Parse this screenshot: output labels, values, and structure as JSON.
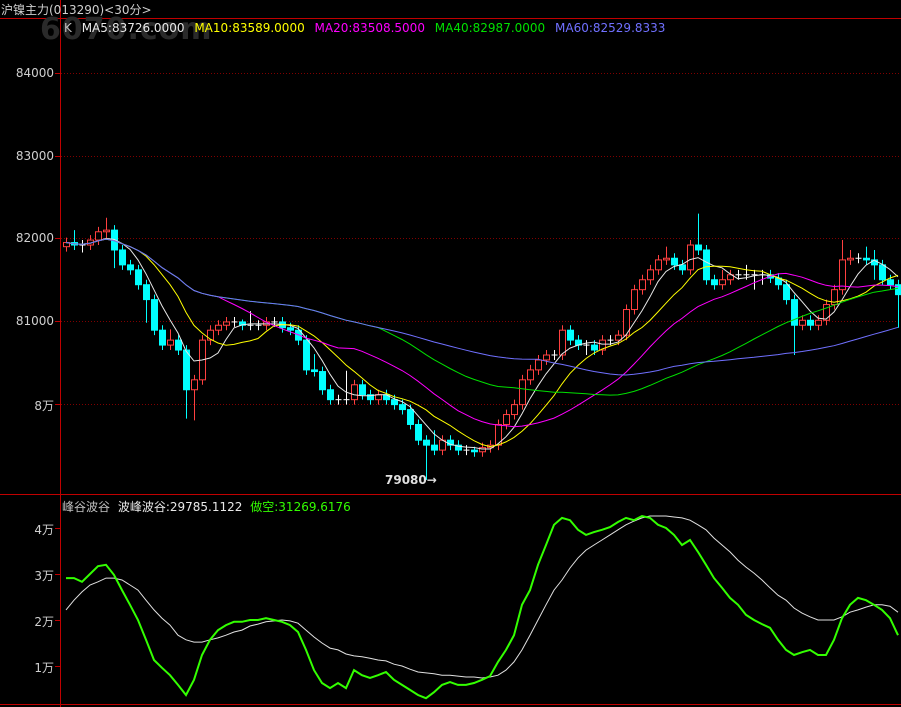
{
  "header": {
    "title": "沪镍主力(013290)<30分>",
    "watermark": "6070.com"
  },
  "legend": {
    "k": "K",
    "ma5": "MA5:83726.0000",
    "ma10": "MA10:83589.0000",
    "ma20": "MA20:83508.5000",
    "ma40": "MA40:82987.0000",
    "ma60": "MA60:82529.8333"
  },
  "colors": {
    "up": "#ff4040",
    "down": "#00ffff",
    "ma5": "#e8e8e8",
    "ma10": "#ffff00",
    "ma20": "#ff00ff",
    "ma40": "#00e000",
    "ma60": "#7070ff",
    "grid": "#800000",
    "frame": "#c00000",
    "ind_white": "#e0e0e0",
    "ind_green": "#33ff00"
  },
  "indicator_legend": {
    "name": "峰谷波谷",
    "white": "波峰波谷:29785.1122",
    "green": "做空:31269.6176"
  },
  "chart_data": [
    {
      "type": "candlestick",
      "title": "沪镍主力(013290)<30分>",
      "y_ticks": [
        {
          "value": 84000,
          "label": "84000"
        },
        {
          "value": 83000,
          "label": "83000"
        },
        {
          "value": 82000,
          "label": "82000"
        },
        {
          "value": 81000,
          "label": "81000"
        },
        {
          "value": 80000,
          "label": "8万"
        }
      ],
      "ylim": [
        79000,
        84900
      ],
      "grid": true,
      "annotation": {
        "label": "79080→",
        "value": 79080
      },
      "ma_periods": [
        5,
        10,
        20,
        40,
        60
      ],
      "candles_ohlc": [
        [
          81900,
          82010,
          81840,
          81950
        ],
        [
          81950,
          82100,
          81860,
          81920
        ],
        [
          81920,
          81980,
          81830,
          81920
        ],
        [
          81920,
          82040,
          81860,
          81980
        ],
        [
          81980,
          82140,
          81920,
          82080
        ],
        [
          82080,
          82250,
          82000,
          82100
        ],
        [
          82100,
          82160,
          81640,
          81860
        ],
        [
          81860,
          81920,
          81620,
          81680
        ],
        [
          81680,
          81740,
          81560,
          81620
        ],
        [
          81620,
          81680,
          81380,
          81440
        ],
        [
          81440,
          81500,
          80980,
          81260
        ],
        [
          81260,
          81320,
          80830,
          80890
        ],
        [
          80890,
          80950,
          80650,
          80710
        ],
        [
          80710,
          80900,
          80650,
          80770
        ],
        [
          80770,
          80830,
          80590,
          80650
        ],
        [
          80650,
          80710,
          79820,
          80170
        ],
        [
          80170,
          80350,
          79800,
          80290
        ],
        [
          80290,
          80830,
          80230,
          80770
        ],
        [
          80770,
          80950,
          80710,
          80890
        ],
        [
          80890,
          81010,
          80830,
          80950
        ],
        [
          80950,
          81050,
          80890,
          80990
        ],
        [
          80990,
          81050,
          80930,
          80990
        ],
        [
          80990,
          81020,
          80890,
          80950
        ],
        [
          80950,
          81120,
          80890,
          80950
        ],
        [
          80950,
          81010,
          80890,
          80950
        ],
        [
          80950,
          81050,
          80890,
          80990
        ],
        [
          80990,
          81050,
          80930,
          80990
        ],
        [
          80990,
          81050,
          80860,
          80920
        ],
        [
          80920,
          80980,
          80830,
          80890
        ],
        [
          80890,
          80950,
          80710,
          80770
        ],
        [
          80770,
          80830,
          80350,
          80410
        ],
        [
          80410,
          80600,
          80330,
          80390
        ],
        [
          80390,
          80450,
          80110,
          80170
        ],
        [
          80170,
          80230,
          79990,
          80050
        ],
        [
          80050,
          80110,
          79990,
          80050
        ],
        [
          80050,
          80400,
          79990,
          80050
        ],
        [
          80050,
          80290,
          79990,
          80230
        ],
        [
          80230,
          80290,
          80050,
          80110
        ],
        [
          80110,
          80170,
          79990,
          80050
        ],
        [
          80050,
          80170,
          79990,
          80110
        ],
        [
          80110,
          80170,
          79990,
          80050
        ],
        [
          80050,
          80110,
          79930,
          79990
        ],
        [
          79990,
          80050,
          79870,
          79930
        ],
        [
          79930,
          79990,
          79690,
          79750
        ],
        [
          79750,
          79810,
          79500,
          79560
        ],
        [
          79560,
          79620,
          79080,
          79500
        ],
        [
          79500,
          79680,
          79380,
          79440
        ],
        [
          79440,
          79620,
          79380,
          79560
        ],
        [
          79560,
          79620,
          79440,
          79500
        ],
        [
          79500,
          79560,
          79380,
          79440
        ],
        [
          79440,
          79500,
          79380,
          79440
        ],
        [
          79440,
          79480,
          79360,
          79420
        ],
        [
          79420,
          79530,
          79360,
          79470
        ],
        [
          79470,
          79560,
          79410,
          79500
        ],
        [
          79500,
          79810,
          79440,
          79750
        ],
        [
          79750,
          79930,
          79690,
          79870
        ],
        [
          79870,
          80050,
          79810,
          79990
        ],
        [
          79990,
          80350,
          79930,
          80290
        ],
        [
          80290,
          80470,
          80230,
          80410
        ],
        [
          80410,
          80590,
          80350,
          80530
        ],
        [
          80530,
          80650,
          80470,
          80590
        ],
        [
          80590,
          80650,
          80530,
          80590
        ],
        [
          80590,
          80950,
          80530,
          80890
        ],
        [
          80890,
          80950,
          80710,
          80770
        ],
        [
          80770,
          80830,
          80650,
          80710
        ],
        [
          80710,
          80770,
          80590,
          80710
        ],
        [
          80710,
          80770,
          80590,
          80650
        ],
        [
          80650,
          80830,
          80590,
          80770
        ],
        [
          80770,
          80830,
          80710,
          80770
        ],
        [
          80770,
          80890,
          80710,
          80830
        ],
        [
          80830,
          81200,
          80770,
          81140
        ],
        [
          81140,
          81440,
          81080,
          81380
        ],
        [
          81380,
          81560,
          81320,
          81500
        ],
        [
          81500,
          81680,
          81440,
          81620
        ],
        [
          81620,
          81800,
          81560,
          81740
        ],
        [
          81740,
          81900,
          81680,
          81760
        ],
        [
          81760,
          81820,
          81620,
          81680
        ],
        [
          81680,
          81740,
          81560,
          81620
        ],
        [
          81620,
          81980,
          81560,
          81920
        ],
        [
          81920,
          82300,
          81800,
          81860
        ],
        [
          81860,
          81920,
          81440,
          81500
        ],
        [
          81500,
          81560,
          81380,
          81440
        ],
        [
          81440,
          81620,
          81380,
          81500
        ],
        [
          81500,
          81620,
          81440,
          81560
        ],
        [
          81560,
          81620,
          81500,
          81560
        ],
        [
          81560,
          81680,
          81500,
          81560
        ],
        [
          81560,
          81620,
          81380,
          81560
        ],
        [
          81560,
          81620,
          81440,
          81560
        ],
        [
          81560,
          81620,
          81460,
          81520
        ],
        [
          81520,
          81580,
          81380,
          81440
        ],
        [
          81440,
          81500,
          81200,
          81260
        ],
        [
          81260,
          81320,
          80590,
          80950
        ],
        [
          80950,
          81070,
          80890,
          81010
        ],
        [
          81010,
          81070,
          80890,
          80950
        ],
        [
          80950,
          81070,
          80890,
          81010
        ],
        [
          81010,
          81260,
          80950,
          81200
        ],
        [
          81200,
          81440,
          81140,
          81380
        ],
        [
          81380,
          81980,
          81320,
          81740
        ],
        [
          81740,
          81860,
          81680,
          81760
        ],
        [
          81760,
          81820,
          81700,
          81760
        ],
        [
          81760,
          81900,
          81680,
          81740
        ],
        [
          81740,
          81860,
          81500,
          81680
        ],
        [
          81680,
          81740,
          81440,
          81500
        ],
        [
          81500,
          81560,
          81380,
          81440
        ],
        [
          81440,
          81500,
          80920,
          81320
        ]
      ]
    },
    {
      "type": "line",
      "title": "峰谷波谷",
      "unit": "万",
      "y_ticks": [
        {
          "value": 4,
          "label": "4万"
        },
        {
          "value": 3,
          "label": "3万"
        },
        {
          "value": 2,
          "label": "2万"
        },
        {
          "value": 1,
          "label": "1万"
        }
      ],
      "series": [
        {
          "name": "波峰波谷",
          "values": [
            2.22,
            2.43,
            2.61,
            2.76,
            2.83,
            2.91,
            2.91,
            2.87,
            2.76,
            2.65,
            2.43,
            2.22,
            2.04,
            1.89,
            1.67,
            1.57,
            1.52,
            1.52,
            1.57,
            1.61,
            1.67,
            1.74,
            1.78,
            1.87,
            1.91,
            1.96,
            1.98,
            2.0,
            1.98,
            1.93,
            1.78,
            1.63,
            1.5,
            1.39,
            1.35,
            1.26,
            1.22,
            1.2,
            1.17,
            1.13,
            1.11,
            1.04,
            1.0,
            0.93,
            0.87,
            0.85,
            0.83,
            0.8,
            0.8,
            0.78,
            0.76,
            0.76,
            0.74,
            0.76,
            0.8,
            0.91,
            1.09,
            1.35,
            1.67,
            2.0,
            2.33,
            2.65,
            2.87,
            3.13,
            3.35,
            3.52,
            3.63,
            3.74,
            3.85,
            3.96,
            4.07,
            4.15,
            4.22,
            4.26,
            4.26,
            4.26,
            4.24,
            4.22,
            4.17,
            4.07,
            3.96,
            3.78,
            3.63,
            3.48,
            3.3,
            3.15,
            3.02,
            2.87,
            2.7,
            2.54,
            2.43,
            2.26,
            2.15,
            2.07,
            2.0,
            2.0,
            2.0,
            2.07,
            2.17,
            2.22,
            2.28,
            2.33,
            2.33,
            2.3,
            2.17
          ]
        },
        {
          "name": "做空",
          "values": [
            2.91,
            2.91,
            2.83,
            3.0,
            3.17,
            3.2,
            2.98,
            2.65,
            2.33,
            2.0,
            1.57,
            1.13,
            0.96,
            0.8,
            0.59,
            0.37,
            0.7,
            1.24,
            1.57,
            1.78,
            1.89,
            1.96,
            1.96,
            2.0,
            2.0,
            2.04,
            2.0,
            1.96,
            1.89,
            1.74,
            1.35,
            0.91,
            0.63,
            0.52,
            0.63,
            0.52,
            0.91,
            0.8,
            0.74,
            0.8,
            0.87,
            0.7,
            0.59,
            0.48,
            0.37,
            0.3,
            0.43,
            0.59,
            0.65,
            0.59,
            0.59,
            0.63,
            0.7,
            0.78,
            1.09,
            1.35,
            1.67,
            2.33,
            2.65,
            3.2,
            3.63,
            4.07,
            4.22,
            4.17,
            3.96,
            3.85,
            3.91,
            3.96,
            4.02,
            4.13,
            4.22,
            4.17,
            4.26,
            4.22,
            4.07,
            4.0,
            3.85,
            3.63,
            3.74,
            3.48,
            3.2,
            2.91,
            2.7,
            2.48,
            2.33,
            2.11,
            2.0,
            1.91,
            1.83,
            1.57,
            1.35,
            1.24,
            1.3,
            1.35,
            1.24,
            1.24,
            1.57,
            2.04,
            2.33,
            2.48,
            2.43,
            2.33,
            2.22,
            2.04,
            1.67
          ]
        }
      ]
    }
  ]
}
